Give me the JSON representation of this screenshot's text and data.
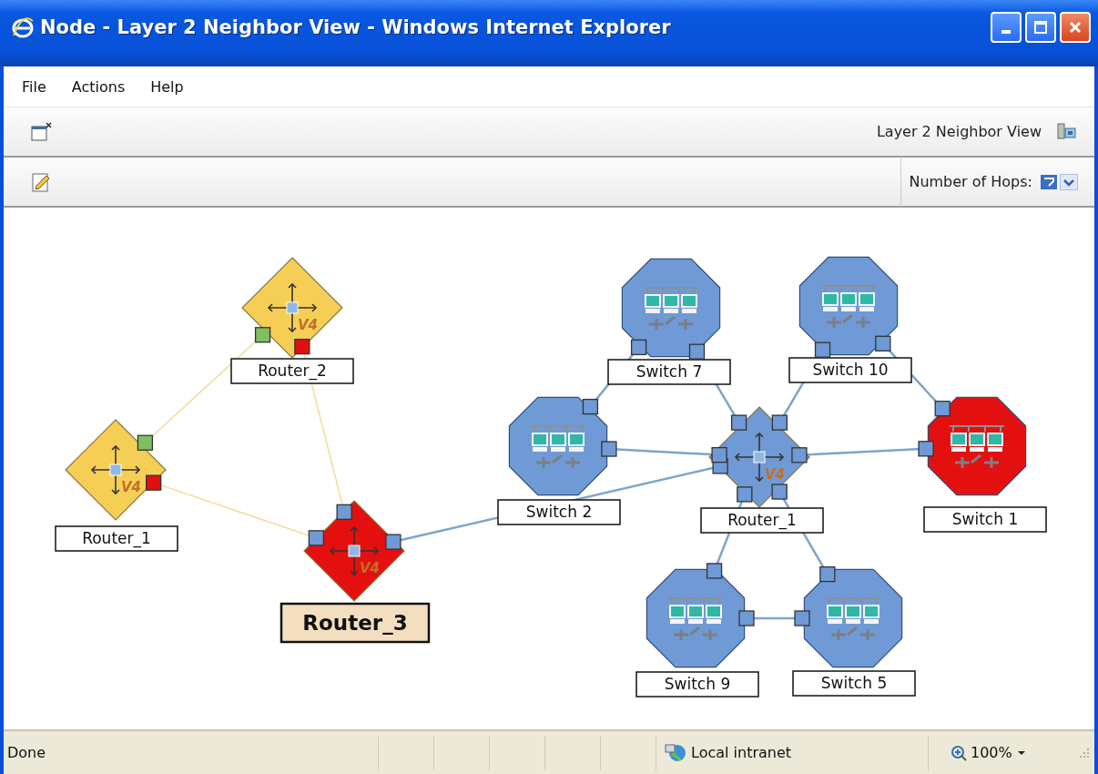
{
  "window": {
    "title": "Node - Layer 2 Neighbor View - Windows Internet Explorer"
  },
  "menu": [
    "File",
    "Actions",
    "Help"
  ],
  "toolbar": {
    "view_name": "Layer 2 Neighbor View"
  },
  "hops": {
    "label": "Number of Hops:"
  },
  "nodes": [
    {
      "kind": "router",
      "label": "Router_2",
      "badge": "V4",
      "color": "#f5cf55",
      "selected": false,
      "ports": [
        {
          "color": "#7fbf5f"
        },
        {
          "color": "#e01010"
        }
      ]
    },
    {
      "kind": "router",
      "label": "Router_1",
      "badge": "V4",
      "color": "#f5cf55",
      "selected": false,
      "ports": [
        {
          "color": "#7fbf5f"
        },
        {
          "color": "#e01010"
        }
      ]
    },
    {
      "kind": "router",
      "label": "Router_3",
      "badge": "V4",
      "color": "#e41010",
      "selected": true,
      "ports": [
        {
          "color": "#6f9ad6"
        },
        {
          "color": "#6f9ad6"
        },
        {
          "color": "#6f9ad6"
        }
      ]
    },
    {
      "kind": "switch",
      "label": "Switch 7",
      "color": "#6f9ad6",
      "selected": false,
      "ports": [
        {
          "color": "#6f9ad6"
        },
        {
          "color": "#6f9ad6"
        }
      ]
    },
    {
      "kind": "switch",
      "label": "Switch 10",
      "color": "#6f9ad6",
      "selected": false,
      "ports": [
        {
          "color": "#6f9ad6"
        },
        {
          "color": "#6f9ad6"
        }
      ]
    },
    {
      "kind": "switch",
      "label": "Switch 2",
      "color": "#6f9ad6",
      "selected": false,
      "ports": [
        {
          "color": "#6f9ad6"
        },
        {
          "color": "#6f9ad6"
        }
      ]
    },
    {
      "kind": "router",
      "label": "Router_1",
      "badge": "V4",
      "color": "#6f9ad6",
      "selected": false,
      "ports": [
        {
          "color": "#6f9ad6"
        },
        {
          "color": "#6f9ad6"
        },
        {
          "color": "#6f9ad6"
        },
        {
          "color": "#6f9ad6"
        },
        {
          "color": "#6f9ad6"
        },
        {
          "color": "#6f9ad6"
        },
        {
          "color": "#6f9ad6"
        }
      ]
    },
    {
      "kind": "switch",
      "label": "Switch 1",
      "color": "#e41010",
      "selected": false,
      "ports": [
        {
          "color": "#6f9ad6"
        },
        {
          "color": "#6f9ad6"
        }
      ]
    },
    {
      "kind": "switch",
      "label": "Switch 9",
      "color": "#6f9ad6",
      "selected": false,
      "ports": [
        {
          "color": "#6f9ad6"
        },
        {
          "color": "#6f9ad6"
        }
      ]
    },
    {
      "kind": "switch",
      "label": "Switch 5",
      "color": "#6f9ad6",
      "selected": false,
      "ports": [
        {
          "color": "#6f9ad6"
        },
        {
          "color": "#6f9ad6"
        }
      ]
    }
  ],
  "status_bar": {
    "text": "Done",
    "zone": "Local intranet",
    "zoom": "100%"
  }
}
